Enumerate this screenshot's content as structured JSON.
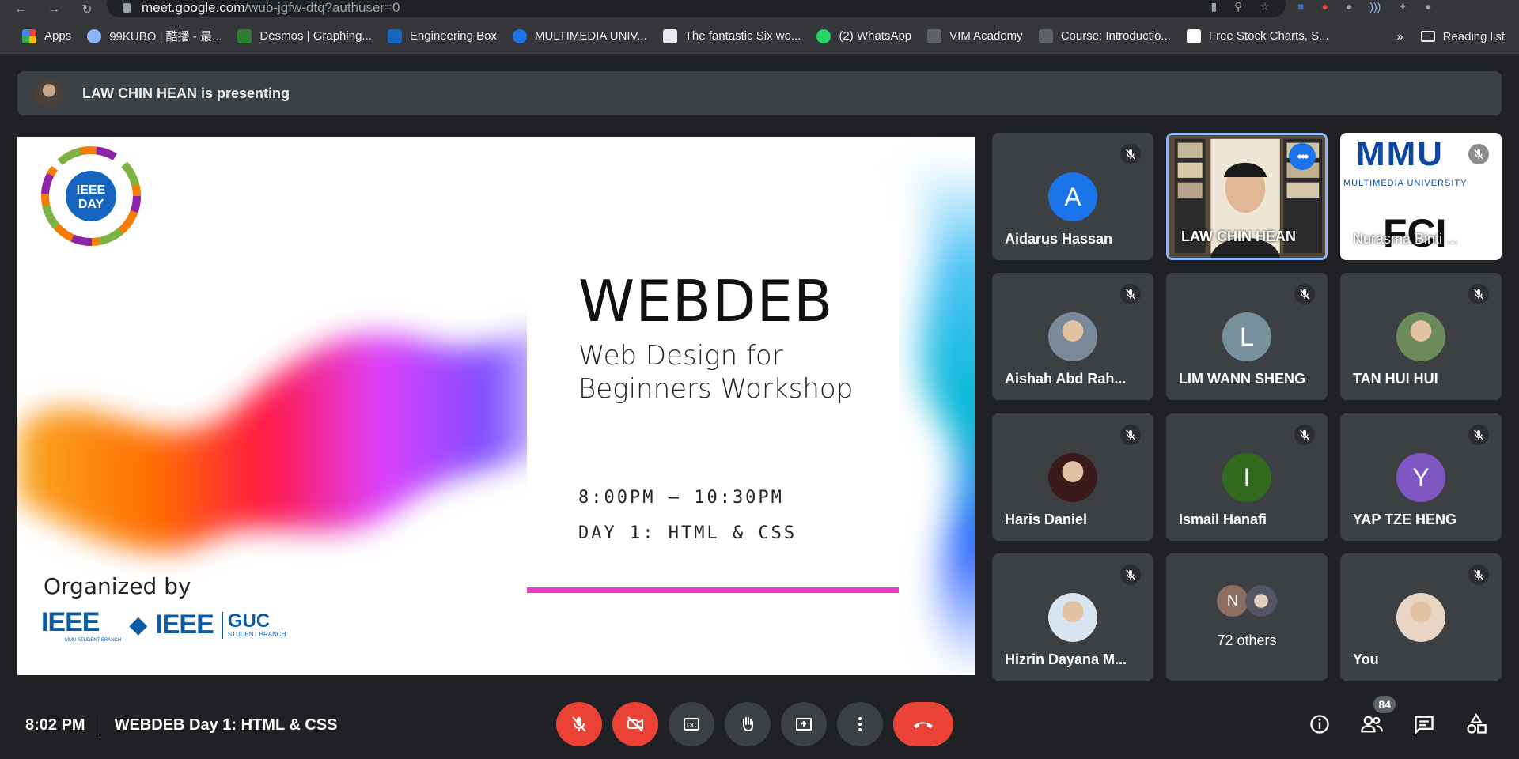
{
  "browser": {
    "url_host": "meet.google.com",
    "url_path": "/wub-jgfw-dtq?authuser=0",
    "bookmarks": [
      {
        "label": "Apps",
        "color": "#ea4335"
      },
      {
        "label": "99KUBO | 酷播 - 最...",
        "color": "#8ab4f8"
      },
      {
        "label": "Desmos | Graphing...",
        "color": "#2e7d32"
      },
      {
        "label": "Engineering Box",
        "color": "#1565c0"
      },
      {
        "label": "MULTIMEDIA UNIV...",
        "color": "#1a73e8"
      },
      {
        "label": "The fantastic Six wo...",
        "color": "#e8eaed"
      },
      {
        "label": "(2) WhatsApp",
        "color": "#25d366"
      },
      {
        "label": "VIM Academy",
        "color": "#5f6368"
      },
      {
        "label": "Course: Introductio...",
        "color": "#5f6368"
      },
      {
        "label": "Free Stock Charts, S...",
        "color": "#ffffff"
      }
    ],
    "overflow": "»",
    "reading_list": "Reading list"
  },
  "presenting": {
    "text": "LAW CHIN HEAN is presenting"
  },
  "slide": {
    "title": "WEBDEB",
    "subtitle": "Web Design for Beginners Workshop",
    "time": "8:00PM – 10:30PM",
    "day": "DAY 1: HTML & CSS",
    "organized_by": "Organized by",
    "logo1": "IEEE",
    "logo1_sub": "MMU STUDENT BRANCH",
    "logo2": "IEEE",
    "logo2_guc": "GUC",
    "logo2_sub": "STUDENT BRANCH",
    "ieee_day_text": "IEEE DAY"
  },
  "participants": [
    {
      "name": "Aidarus Hassan",
      "initial": "A",
      "color": "#1a73e8",
      "muted": true
    },
    {
      "name": "LAW CHIN HEAN",
      "initial": "",
      "color": "",
      "muted": false,
      "video": true
    },
    {
      "name": "Nurasma Binti ...",
      "initial": "",
      "color": "",
      "muted": true,
      "video": true
    },
    {
      "name": "Aishah Abd Rah...",
      "initial": "",
      "color": "#7a8a9a",
      "muted": true
    },
    {
      "name": "LIM WANN SHENG",
      "initial": "L",
      "color": "#78909c",
      "muted": true
    },
    {
      "name": "TAN HUI HUI",
      "initial": "",
      "color": "#6d8a5a",
      "muted": true
    },
    {
      "name": "Haris Daniel",
      "initial": "",
      "color": "#3a1a1a",
      "muted": true
    },
    {
      "name": "Ismail Hanafi",
      "initial": "I",
      "color": "#33691e",
      "muted": true
    },
    {
      "name": "YAP TZE HENG",
      "initial": "Y",
      "color": "#7e57c2",
      "muted": true
    },
    {
      "name": "Hizrin Dayana M...",
      "initial": "",
      "color": "#d8e4f0",
      "muted": true
    },
    {
      "name": "72 others",
      "initial": "N",
      "color": "#8d6e63",
      "muted": false
    },
    {
      "name": "You",
      "initial": "",
      "color": "#e8d5c4",
      "muted": true
    }
  ],
  "nurasma_logo": {
    "top": "MMU",
    "sub": "MULTIMEDIA UNIVERSITY",
    "bottom": "FCI"
  },
  "meeting": {
    "time": "8:02 PM",
    "title": "WEBDEB Day 1: HTML & CSS",
    "participant_count": "84"
  }
}
